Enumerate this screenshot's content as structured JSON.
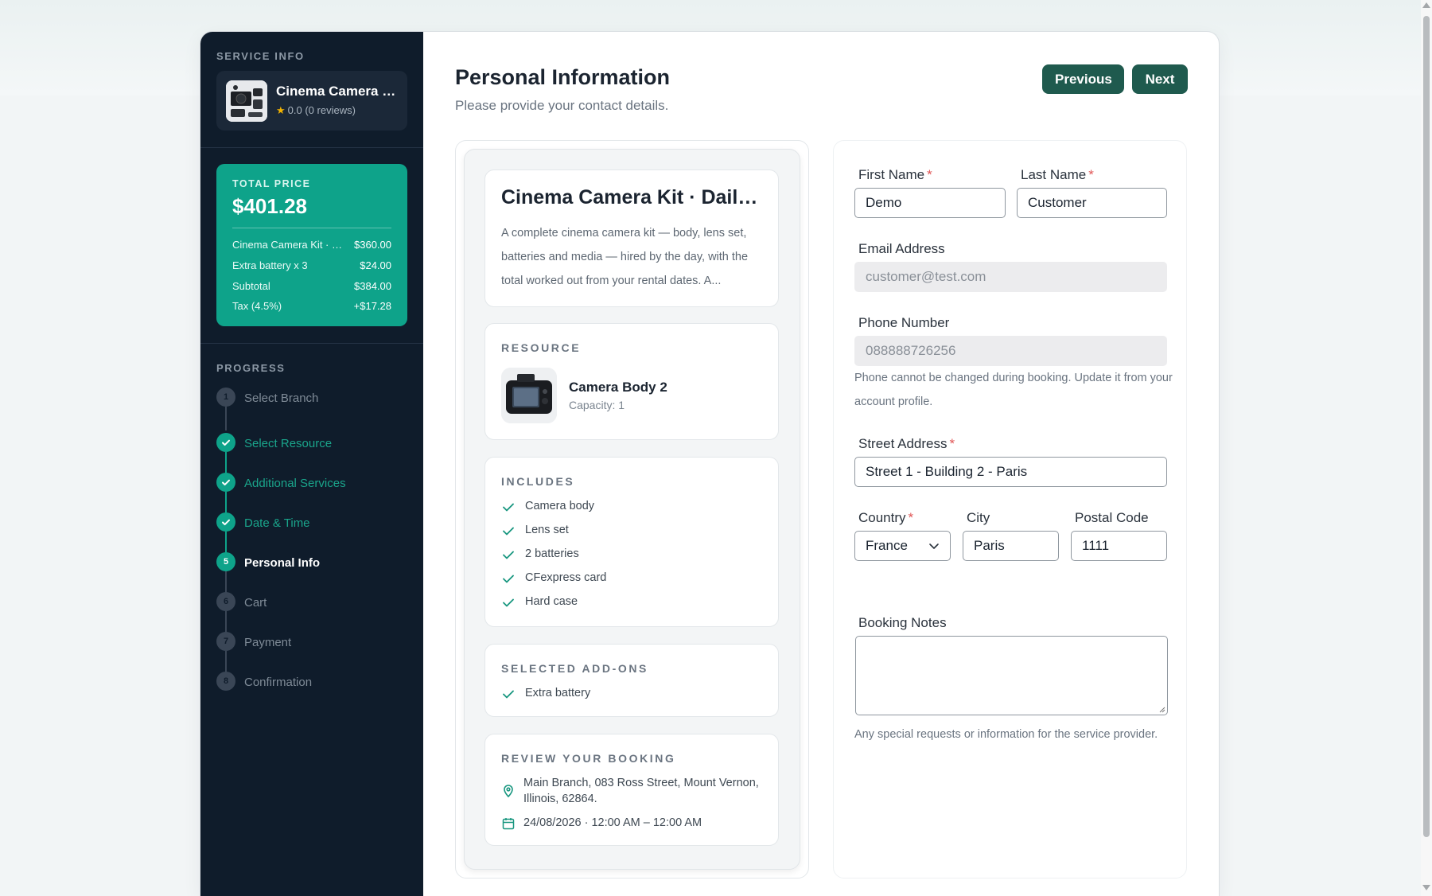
{
  "sidebar": {
    "service_info_label": "SERVICE INFO",
    "service_name": "Cinema Camera Kit · Daily Hire",
    "rating_text": "0.0 (0 reviews)",
    "price": {
      "label": "TOTAL PRICE",
      "total": "$401.28",
      "rows": [
        {
          "name": "Cinema Camera Kit · Daily Hire",
          "value": "$360.00"
        },
        {
          "name": "Extra battery x 3",
          "value": "$24.00"
        },
        {
          "name": "Subtotal",
          "value": "$384.00"
        },
        {
          "name": "Tax (4.5%)",
          "value": "+$17.28"
        }
      ]
    },
    "progress_label": "PROGRESS",
    "steps": [
      {
        "num": "1",
        "label": "Select Branch",
        "state": "pending"
      },
      {
        "num": "2",
        "label": "Select Resource",
        "state": "done"
      },
      {
        "num": "3",
        "label": "Additional Services",
        "state": "done"
      },
      {
        "num": "4",
        "label": "Date & Time",
        "state": "done"
      },
      {
        "num": "5",
        "label": "Personal Info",
        "state": "active"
      },
      {
        "num": "6",
        "label": "Cart",
        "state": "pending"
      },
      {
        "num": "7",
        "label": "Payment",
        "state": "pending"
      },
      {
        "num": "8",
        "label": "Confirmation",
        "state": "pending"
      }
    ]
  },
  "header": {
    "title": "Personal Information",
    "subtitle": "Please provide your contact details.",
    "prev_label": "Previous",
    "next_label": "Next"
  },
  "summary": {
    "title": "Cinema Camera Kit · Daily Hire",
    "description": "A complete cinema camera kit — body, lens set, batteries and media — hired by the day, with the total worked out from your rental dates. A...",
    "resource_heading": "RESOURCE",
    "resource_name": "Camera Body 2",
    "resource_capacity": "Capacity: 1",
    "includes_heading": "INCLUDES",
    "includes": [
      "Camera body",
      "Lens set",
      "2 batteries",
      "CFexpress card",
      "Hard case"
    ],
    "addons_heading": "SELECTED ADD-ONS",
    "addons": [
      "Extra battery"
    ],
    "review_heading": "REVIEW YOUR BOOKING",
    "location": "Main Branch, 083 Ross Street, Mount Vernon, Illinois, 62864.",
    "datetime": "24/08/2026 · 12:00 AM – 12:00 AM"
  },
  "form": {
    "first_name_label": "First Name",
    "first_name": "Demo",
    "last_name_label": "Last Name",
    "last_name": "Customer",
    "email_label": "Email Address",
    "email": "customer@test.com",
    "phone_label": "Phone Number",
    "phone": "088888726256",
    "phone_help": "Phone cannot be changed during booking. Update it from your account profile.",
    "street_label": "Street Address",
    "street": "Street 1 - Building 2 - Paris",
    "country_label": "Country",
    "country": "France",
    "city_label": "City",
    "city": "Paris",
    "postal_label": "Postal Code",
    "postal": "1111",
    "notes_label": "Booking Notes",
    "notes": "",
    "notes_help": "Any special requests or information for the service provider.",
    "required_mark": "*"
  },
  "colors": {
    "sidebar_bg": "#0f1c2b",
    "accent": "#0ea38a",
    "button": "#1f5a4e",
    "required": "#e05555"
  }
}
